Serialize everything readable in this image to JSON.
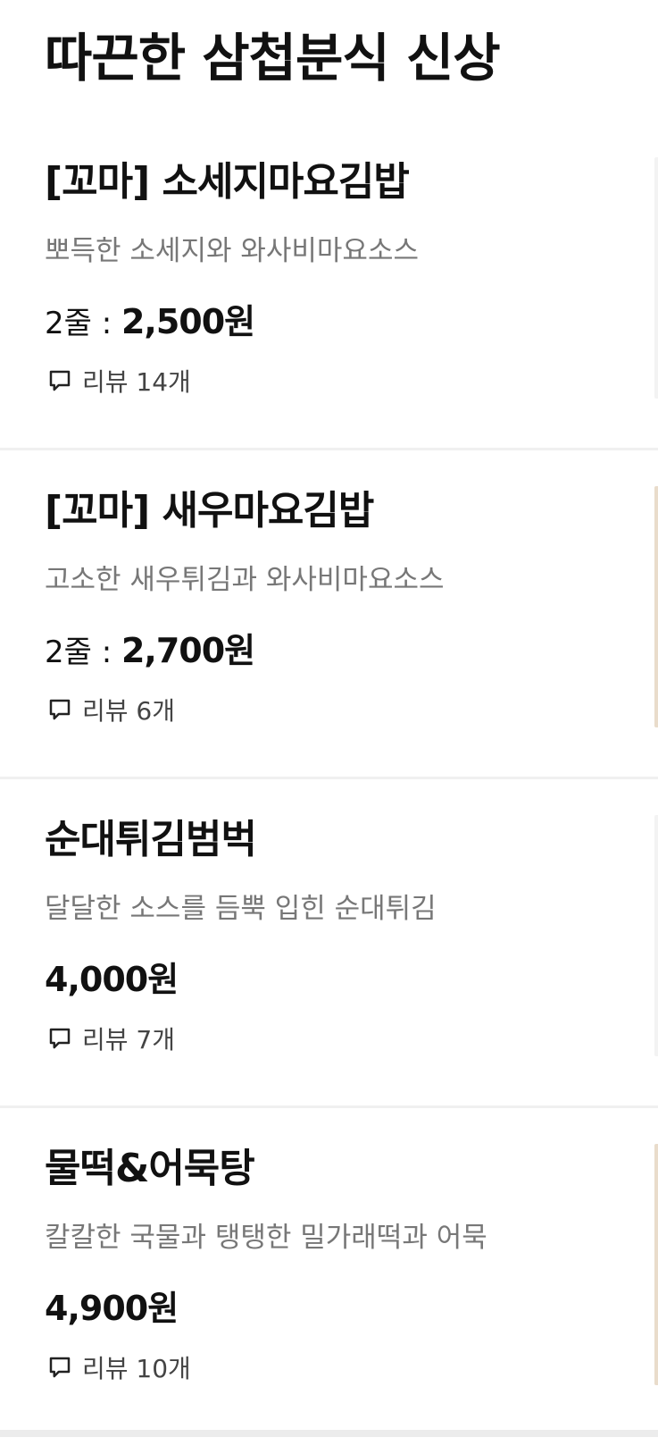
{
  "section": {
    "title": "따끈한 삼첩분식 신상"
  },
  "items": [
    {
      "name": "[꼬마] 소세지마요김밥",
      "description": "뽀득한 소세지와 와사비마요소스",
      "price_option": "2줄 : ",
      "price": "2,500원",
      "review_label": "리뷰 14개"
    },
    {
      "name": "[꼬마] 새우마요김밥",
      "description": "고소한 새우튀김과 와사비마요소스",
      "price_option": "2줄 : ",
      "price": "2,700원",
      "review_label": "리뷰 6개"
    },
    {
      "name": "순대튀김범벅",
      "description": "달달한 소스를 듬뿍 입힌 순대튀김",
      "price_option": "",
      "price": "4,000원",
      "review_label": "리뷰 7개"
    },
    {
      "name": "물떡&어묵탕",
      "description": "칼칼한 국물과 탱탱한 밀가래떡과 어묵",
      "price_option": "",
      "price": "4,900원",
      "review_label": "리뷰 10개"
    }
  ],
  "icons": {
    "review": "speech-bubble-icon"
  },
  "colors": {
    "text_primary": "#111111",
    "text_secondary": "#777777",
    "divider": "#f0f0f0"
  }
}
